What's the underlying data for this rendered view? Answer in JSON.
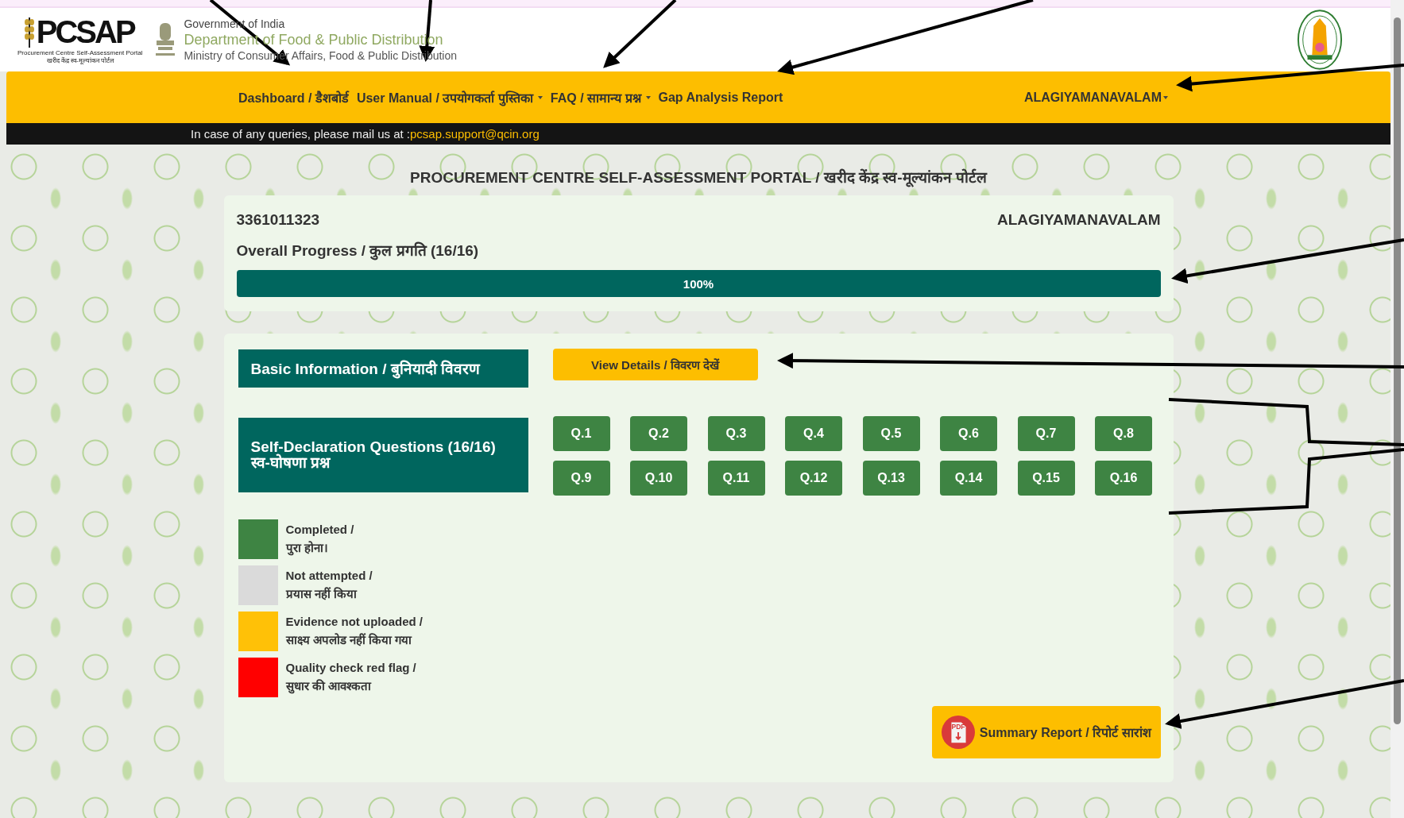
{
  "header": {
    "logo": {
      "acronym": "PCSAP",
      "subtitle_en": "Procurement Centre Self-Assessment Portal",
      "subtitle_hi": "खरीद केंद्र स्व-मूल्यांकन पोर्टल"
    },
    "org": {
      "line1": "Government of India",
      "line2": "Department of Food & Public Distribution",
      "line3": "Ministry of  Consumer Affairs, Food & Public Distribution"
    }
  },
  "nav": {
    "items": [
      {
        "label": "Dashboard / डैशबोर्ड",
        "dropdown": false
      },
      {
        "label": "User Manual / उपयोगकर्ता पुस्तिका",
        "dropdown": true
      },
      {
        "label": "FAQ / सामान्य प्रश्न",
        "dropdown": true
      },
      {
        "label": "Gap Analysis Report",
        "dropdown": false
      }
    ],
    "user": {
      "label": "ALAGIYAMANAVALAM",
      "dropdown": true
    }
  },
  "notice": {
    "text": "In case of any queries, please mail us at :",
    "email": "pcsap.support@qcin.org"
  },
  "page_title": "PROCUREMENT CENTRE SELF-ASSESSMENT PORTAL / खरीद केंद्र स्व-मूल्यांकन पोर्टल",
  "progress": {
    "code": "3361011323",
    "name": "ALAGIYAMANAVALAM",
    "label": "Overall Progress / कुल प्रगति (16/16)",
    "level": 1,
    "reading": "100%"
  },
  "basic_info": {
    "label": "Basic Information / बुनियादी विवरण",
    "button": "View Details / विवरण देखें"
  },
  "questions": {
    "label_en": "Self-Declaration Questions (16/16)",
    "label_hi": "स्व-घोषणा प्रश्न",
    "items": [
      {
        "label": "Q.1",
        "color": "#3e8443"
      },
      {
        "label": "Q.2",
        "color": "#3e8443"
      },
      {
        "label": "Q.3",
        "color": "#3e8443"
      },
      {
        "label": "Q.4",
        "color": "#3e8443"
      },
      {
        "label": "Q.5",
        "color": "#3e8443"
      },
      {
        "label": "Q.6",
        "color": "#3e8443"
      },
      {
        "label": "Q.7",
        "color": "#3e8443"
      },
      {
        "label": "Q.8",
        "color": "#3e8443"
      },
      {
        "label": "Q.9",
        "color": "#3e8443"
      },
      {
        "label": "Q.10",
        "color": "#3e8443"
      },
      {
        "label": "Q.11",
        "color": "#3e8443"
      },
      {
        "label": "Q.12",
        "color": "#3e8443"
      },
      {
        "label": "Q.13",
        "color": "#3e8443"
      },
      {
        "label": "Q.14",
        "color": "#3e8443"
      },
      {
        "label": "Q.15",
        "color": "#3e8443"
      },
      {
        "label": "Q.16",
        "color": "#3e8443"
      }
    ]
  },
  "legend": [
    {
      "color": "#3e8443",
      "label_en": "Completed /",
      "label_hi": "पुरा होना।"
    },
    {
      "color": "#dadada",
      "label_en": "Not attempted /",
      "label_hi": "प्रयास नहीं किया"
    },
    {
      "color": "#ffc107",
      "label_en": "Evidence not uploaded /",
      "label_hi": "साक्ष्य अपलोड नहीं किया गया"
    },
    {
      "color": "#ff0000",
      "label_en": "Quality check red flag /",
      "label_hi": "सुधार की आवश्कता"
    }
  ],
  "summary_button": {
    "label": "Summary Report / रिपोर्ट सारांश",
    "icon_text": "PDF"
  }
}
